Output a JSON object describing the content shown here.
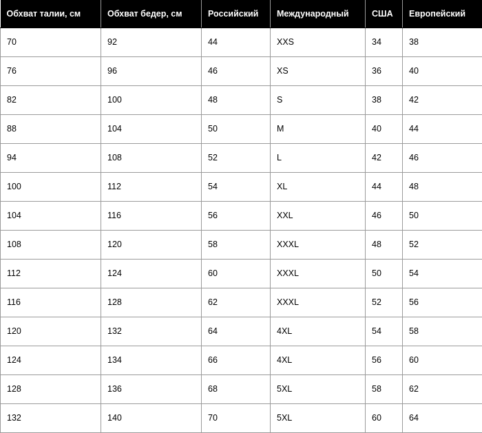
{
  "table": {
    "name": "size-conversion-table",
    "colors": {
      "header_background": "#000000",
      "header_text": "#ffffff",
      "body_background": "#ffffff",
      "body_text": "#000000",
      "border": "#9a9a9a"
    },
    "columns": [
      {
        "key": "waist",
        "label": "Обхват талии, см"
      },
      {
        "key": "hips",
        "label": "Обхват бедер, см"
      },
      {
        "key": "ru",
        "label": "Российский"
      },
      {
        "key": "intl",
        "label": "Международный"
      },
      {
        "key": "usa",
        "label": "США"
      },
      {
        "key": "eu",
        "label": "Европейский"
      }
    ],
    "rows": [
      {
        "waist": "70",
        "hips": "92",
        "ru": "44",
        "intl": "XXS",
        "usa": "34",
        "eu": "38"
      },
      {
        "waist": "76",
        "hips": "96",
        "ru": "46",
        "intl": "XS",
        "usa": "36",
        "eu": "40"
      },
      {
        "waist": "82",
        "hips": "100",
        "ru": "48",
        "intl": "S",
        "usa": "38",
        "eu": "42"
      },
      {
        "waist": "88",
        "hips": "104",
        "ru": "50",
        "intl": "M",
        "usa": "40",
        "eu": "44"
      },
      {
        "waist": "94",
        "hips": "108",
        "ru": "52",
        "intl": "L",
        "usa": "42",
        "eu": "46"
      },
      {
        "waist": "100",
        "hips": "112",
        "ru": "54",
        "intl": "XL",
        "usa": "44",
        "eu": "48"
      },
      {
        "waist": "104",
        "hips": "116",
        "ru": "56",
        "intl": "XXL",
        "usa": "46",
        "eu": "50"
      },
      {
        "waist": "108",
        "hips": "120",
        "ru": "58",
        "intl": "XXXL",
        "usa": "48",
        "eu": "52"
      },
      {
        "waist": "112",
        "hips": "124",
        "ru": "60",
        "intl": "XXXL",
        "usa": "50",
        "eu": "54"
      },
      {
        "waist": "116",
        "hips": "128",
        "ru": "62",
        "intl": "XXXL",
        "usa": "52",
        "eu": "56"
      },
      {
        "waist": "120",
        "hips": "132",
        "ru": "64",
        "intl": "4XL",
        "usa": "54",
        "eu": "58"
      },
      {
        "waist": "124",
        "hips": "134",
        "ru": "66",
        "intl": "4XL",
        "usa": "56",
        "eu": "60"
      },
      {
        "waist": "128",
        "hips": "136",
        "ru": "68",
        "intl": "5XL",
        "usa": "58",
        "eu": "62"
      },
      {
        "waist": "132",
        "hips": "140",
        "ru": "70",
        "intl": "5XL",
        "usa": "60",
        "eu": "64"
      }
    ]
  }
}
